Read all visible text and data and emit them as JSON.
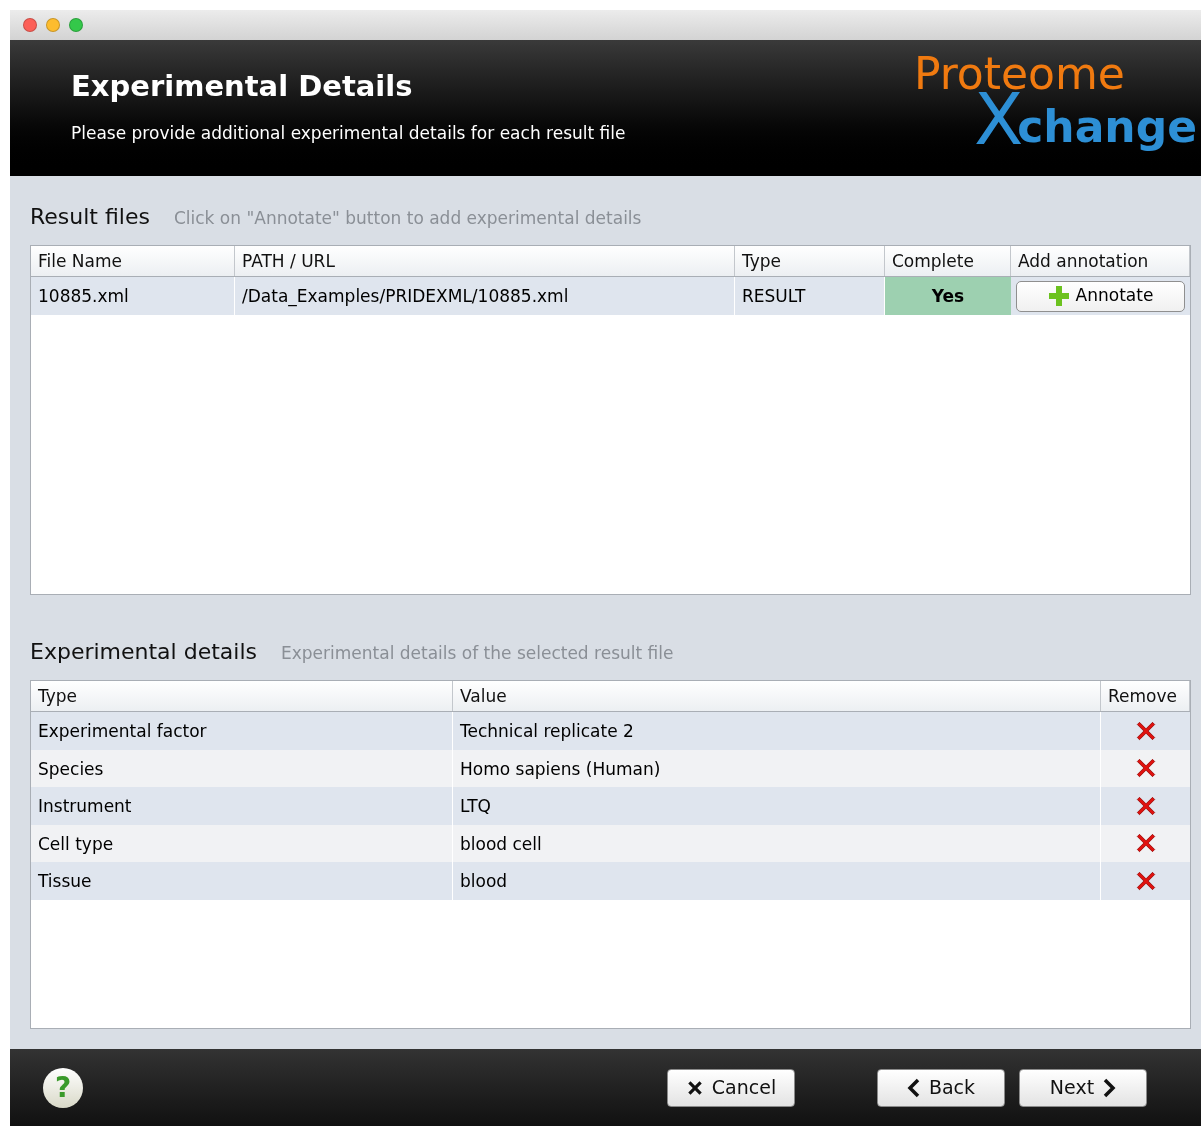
{
  "header": {
    "title": "Experimental Details",
    "subtitle": "Please provide additional experimental details for each result file",
    "logo": {
      "top": "Proteome",
      "bottom_initial": "X",
      "bottom": "change"
    }
  },
  "result_files": {
    "title": "Result files",
    "hint": "Click on \"Annotate\" button to add experimental details",
    "columns": [
      "File Name",
      "PATH / URL",
      "Type",
      "Complete",
      "Add annotation"
    ],
    "rows": [
      {
        "file_name": "10885.xml",
        "path": "/Data_Examples/PRIDEXML/10885.xml",
        "type": "RESULT",
        "complete": true,
        "complete_label": "Yes",
        "action": "Annotate",
        "selected": true
      }
    ]
  },
  "experimental_details": {
    "title": "Experimental details",
    "hint": "Experimental details of the selected result file",
    "columns": [
      "Type",
      "Value",
      "Remove"
    ],
    "rows": [
      {
        "type": "Experimental factor",
        "value": "Technical replicate 2"
      },
      {
        "type": "Species",
        "value": "Homo sapiens (Human)"
      },
      {
        "type": "Instrument",
        "value": "LTQ"
      },
      {
        "type": "Cell type",
        "value": "blood cell"
      },
      {
        "type": "Tissue",
        "value": "blood"
      }
    ]
  },
  "footer": {
    "help": "?",
    "buttons": [
      {
        "kind": "cancel",
        "label": "Cancel"
      },
      {
        "kind": "back",
        "label": "Back"
      },
      {
        "kind": "next",
        "label": "Next"
      }
    ]
  }
}
